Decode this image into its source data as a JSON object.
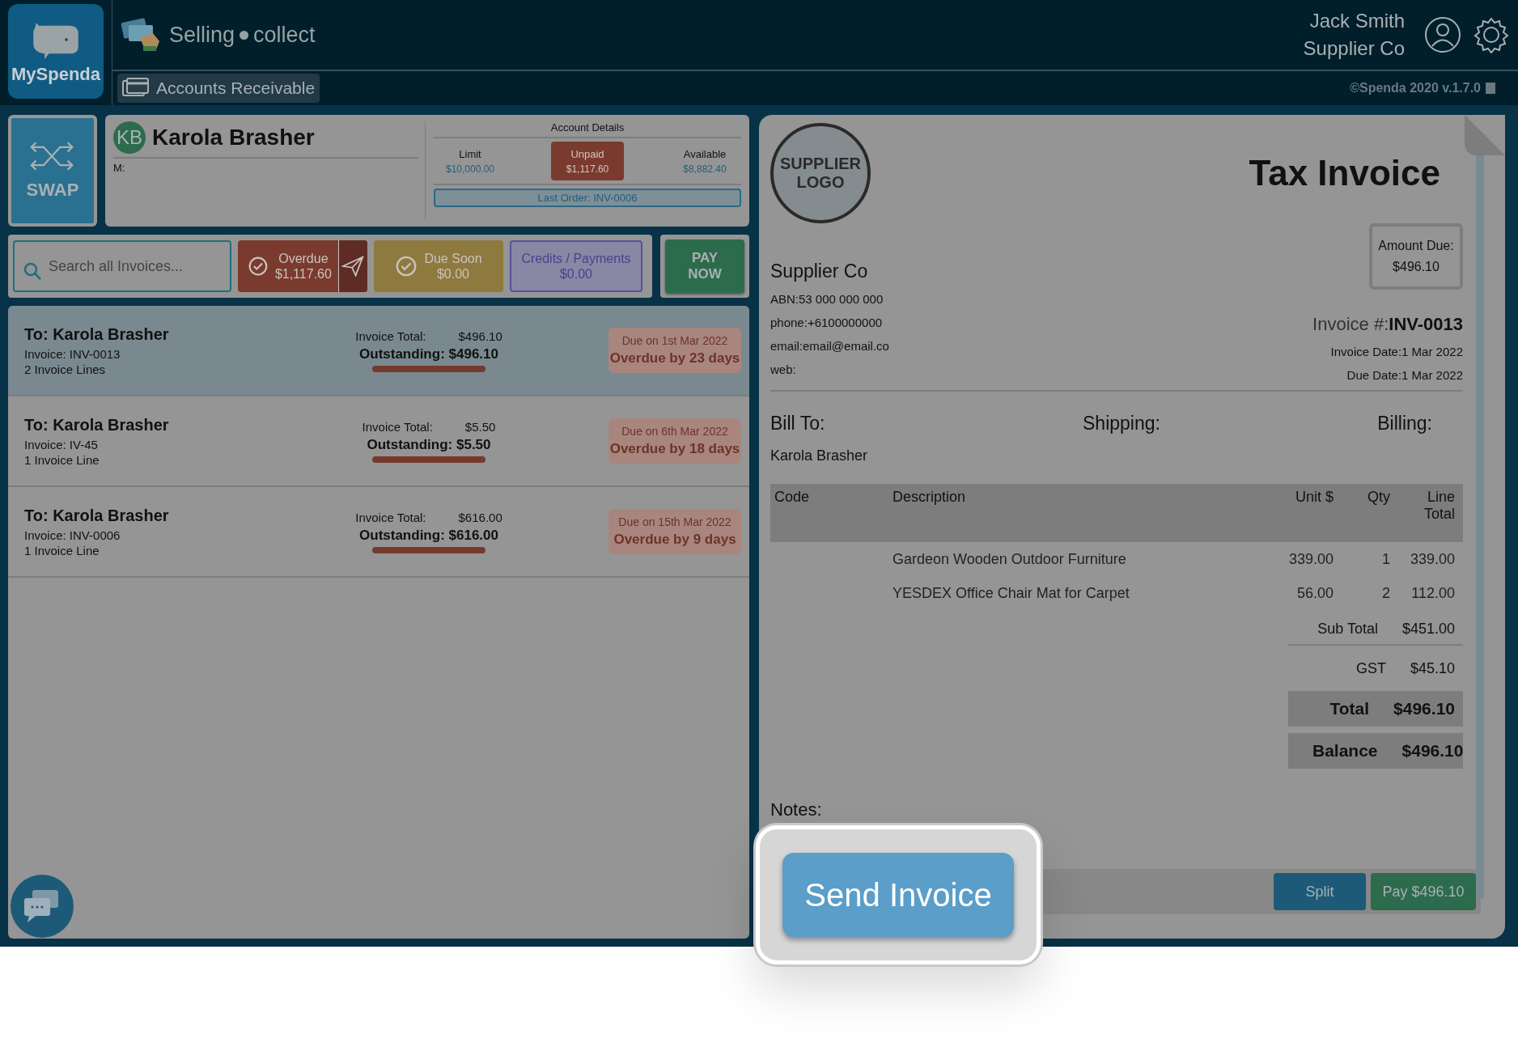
{
  "header": {
    "logo_text": "MySpenda",
    "module": "Selling",
    "module_sub": "collect",
    "tabs": [
      {
        "label": "Accounts Receivable",
        "selected": true
      }
    ],
    "user_name": "Jack Smith",
    "user_company": "Supplier Co",
    "version": "©Spenda 2020 v.1.7.0"
  },
  "swap_label": "SWAP",
  "customer": {
    "initials": "KB",
    "name": "Karola Brasher",
    "mobile_label": "M:",
    "account_title": "Account Details",
    "stats": [
      {
        "label": "Limit",
        "value": "$10,000.00",
        "highlighted": false
      },
      {
        "label": "Unpaid",
        "value": "$1,117.60",
        "highlighted": true
      },
      {
        "label": "Available",
        "value": "$8,882.40",
        "highlighted": false
      }
    ],
    "last_order": "Last Order: INV-0006"
  },
  "search": {
    "placeholder": "Search all Invoices..."
  },
  "filters": [
    {
      "kind": "overdue",
      "label": "Overdue",
      "amount": "$1,117.60"
    },
    {
      "kind": "due_soon",
      "label": "Due Soon",
      "amount": "$0.00"
    },
    {
      "kind": "credits",
      "label": "Credits / Payments",
      "amount": "$0.00"
    }
  ],
  "pay_now": "PAY NOW",
  "invoices": [
    {
      "to": "To: Karola Brasher",
      "number": "Invoice: INV-0013",
      "lines": "2 Invoice Lines",
      "total_label": "Invoice Total:",
      "total": "$496.10",
      "outstanding": "Outstanding: $496.10",
      "due": "Due on 1st Mar 2022",
      "overdue": "Overdue by 23 days",
      "selected": true
    },
    {
      "to": "To: Karola Brasher",
      "number": "Invoice: IV-45",
      "lines": "1 Invoice Line",
      "total_label": "Invoice Total:",
      "total": "$5.50",
      "outstanding": "Outstanding: $5.50",
      "due": "Due on 6th Mar 2022",
      "overdue": "Overdue by 18 days",
      "selected": false
    },
    {
      "to": "To: Karola Brasher",
      "number": "Invoice: INV-0006",
      "lines": "1 Invoice Line",
      "total_label": "Invoice Total:",
      "total": "$616.00",
      "outstanding": "Outstanding: $616.00",
      "due": "Due on 15th Mar 2022",
      "overdue": "Overdue by 9 days",
      "selected": false
    }
  ],
  "invoice": {
    "logo_text": "SUPPLIER LOGO",
    "title": "Tax Invoice",
    "amount_due_label": "Amount Due:",
    "amount_due": "$496.10",
    "supplier": "Supplier Co",
    "supplier_details": [
      "ABN:53 000 000 000",
      "phone:+6100000000",
      "email:email@email.co",
      "web:"
    ],
    "number_label": "Invoice #:",
    "number": "INV-0013",
    "dates": [
      "Invoice Date:1 Mar 2022",
      "Due Date:1 Mar 2022"
    ],
    "address_headings": [
      "Bill To:",
      "Shipping:",
      "Billing:"
    ],
    "bill_to_name": "Karola Brasher",
    "columns": [
      "Code",
      "Description",
      "Unit $",
      "Qty",
      "Line Total"
    ],
    "lines": [
      {
        "description": "Gardeon Wooden Outdoor Furniture",
        "unit": "339.00",
        "qty": "1",
        "total": "339.00"
      },
      {
        "description": "YESDEX Office Chair Mat for Carpet",
        "unit": "56.00",
        "qty": "2",
        "total": "112.00"
      }
    ],
    "totals": [
      {
        "kind": "plain",
        "label": "Sub Total",
        "value": "$451.00"
      },
      {
        "kind": "plain",
        "label": "GST",
        "value": "$45.10"
      },
      {
        "kind": "strong",
        "label": "Total",
        "value": "$496.10"
      },
      {
        "kind": "strong",
        "label": "Balance",
        "value": "$496.10"
      }
    ],
    "notes_label": "Notes:",
    "split_label": "Split",
    "pay_label": "Pay $496.10"
  },
  "send_button": "Send Invoice"
}
